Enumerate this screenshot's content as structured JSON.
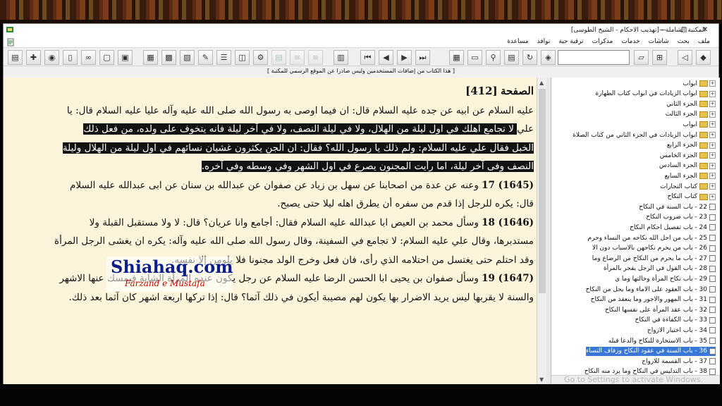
{
  "window": {
    "title": "المكتبة الشاملة - [تهذيب الاحكام - الشيخ الطوسى]",
    "controls": [
      "✕",
      "▢",
      "—"
    ]
  },
  "menu": [
    "ملف",
    "بحث",
    "شاشات",
    "خدمات",
    "مذكرات",
    "ترقية حية",
    "نوافذ",
    "مساعدة"
  ],
  "notice": "[ هذا الكتاب من إضافات المستخدمين وليس صادرا عن الموقع الرسمي للمكتبة ]",
  "content": {
    "page_label": "الصفحة",
    "page_number": "[412]",
    "line1": "عليه السلام عن ابيه عن جده عليه السلام قال: ان فيما اوصى به رسول الله صلى الله عليه وآله عليا عليه السلام قال: يا",
    "line2_pre": "علي",
    "line2_hl": " لا تجامع اهلك في اول ليلة من الهلال، ولا في ليلة النصف، ولا في آخر ليلة فانه يتخوف على ولده، من فعل ذلك",
    "line3_hl": "الخبل فقال علي عليه السلام: ولم ذلك يا رسول الله؟ فقال: ان الجن يكثرون غشيان نسائهم في اول ليلة من الهلال وليلة",
    "line4_hl": "النصف وفى آخر ليلة، اما رأيت المجنون يصرع في اول الشهر وفي وسطه وفي آخره.",
    "h1645_num": "(1645) 17",
    "h1645_text": " وعنه عن عدة من اصحابنا عن سهل بن زياد عن صفوان عن عبدالله بن سنان عن ابى عبدالله عليه السلام",
    "h1645_line2": "قال: يكره للرجل إذا قدم من سفره أن يطرق اهله ليلا حتى يصبح.",
    "h1646_num": "(1646) 18",
    "h1646_text": " وسأل محمد بن العيص ابا عبدالله عليه السلام فقال: أجامع وانا عريان؟ قال: لا ولا مستقبل القبلة ولا",
    "h1646_line2": "مستدبرها، وقال علي عليه السلام: لا تجامع في السفينة، وقال رسول الله صلى الله عليه وآله: يكره ان يغشى الرجل المرأة",
    "h1646_line3": "وقد احتلم حتى يغتسل من احتلامه الذي رأى، فان فعل وخرج الولد مجنونا فلا يلومن إلا نفسه.",
    "h1647_num": "(1647) 19",
    "h1647_text": " وسأل صفوان بن يحيى ابا الحسن الرضا عليه السلام عن رجل يكون عنده المرأة الشابة فيمسك عنها الاشهر",
    "h1647_line2": "والسنة لا يقربها ليس يريد الاضرار بها يكون لهم مصيبة أيكون في ذلك آثما؟ قال: إذا تركها اربعة اشهر كان آثما بعد ذلك."
  },
  "watermark": {
    "line1": "Shiahaq.com",
    "line2": "Farzand e Mustafa"
  },
  "tree": [
    {
      "label": "ابواب",
      "kind": "folder"
    },
    {
      "label": "ابواب الزيادات في ابواب كتاب الطهارة",
      "kind": "folder"
    },
    {
      "label": "الجزء الثاني",
      "kind": "folder"
    },
    {
      "label": "الجزء الثالث",
      "kind": "folder"
    },
    {
      "label": "ابواب",
      "kind": "folder"
    },
    {
      "label": "ابواب الزيادات في الجزء الثاني من كتاب الصلاة",
      "kind": "folder"
    },
    {
      "label": "الجزء الرابع",
      "kind": "folder"
    },
    {
      "label": "الجزء الخامس",
      "kind": "folder"
    },
    {
      "label": "الجزء السادس",
      "kind": "folder"
    },
    {
      "label": "الجزء السابع",
      "kind": "folder"
    },
    {
      "label": "كتاب التجارات",
      "kind": "folder"
    },
    {
      "label": "كتاب النكاح",
      "kind": "folder"
    },
    {
      "label": "22 - باب السنة في النكاح",
      "kind": "item"
    },
    {
      "label": "23 - باب ضروب النكاح",
      "kind": "item"
    },
    {
      "label": "24 - باب تفصيل احكام النكاح",
      "kind": "item"
    },
    {
      "label": "25 - باب من احل الله نكاحه من النساء وحرم",
      "kind": "item"
    },
    {
      "label": "26 - باب من يحرم نكاحهن بالاسباب دون الا",
      "kind": "item"
    },
    {
      "label": "27 - باب ما يحرم من النكاح من الرضاع وما",
      "kind": "item"
    },
    {
      "label": "28 - باب القول في الرجل يفجر بالمرأة",
      "kind": "item"
    },
    {
      "label": "29 - باب نكاح المرأة وخالتها وما ي",
      "kind": "item"
    },
    {
      "label": "30 - باب العقود على الاماء وما يحل من النكاح",
      "kind": "item"
    },
    {
      "label": "31 - باب المهور والاجور وما ينعقد من النكاح",
      "kind": "item"
    },
    {
      "label": "32 - باب عقد المرأة على نفسها النكاح",
      "kind": "item"
    },
    {
      "label": "33 - باب الكفاءة في النكاح",
      "kind": "item"
    },
    {
      "label": "34 - باب اختيار الازواج",
      "kind": "item"
    },
    {
      "label": "35 - باب الاستخارة للنكاح والدعا قبله",
      "kind": "item"
    },
    {
      "label": "36 - باب السنة في عقود النكاح وزفاف النساء",
      "kind": "item",
      "selected": true
    },
    {
      "label": "37 - باب القسمة للازواج",
      "kind": "item"
    },
    {
      "label": "38 - باب التدليس في النكاح وما يرد منه النكاح",
      "kind": "item"
    }
  ],
  "os_overlay": "Go to Settings to activate Windows.",
  "colors": {
    "page_bg": "#fcf5dc",
    "highlight": "#121212",
    "watermark_blue": "#0a1f8a",
    "watermark_red": "#cc0000",
    "tree_selected": "#3a78d8"
  }
}
